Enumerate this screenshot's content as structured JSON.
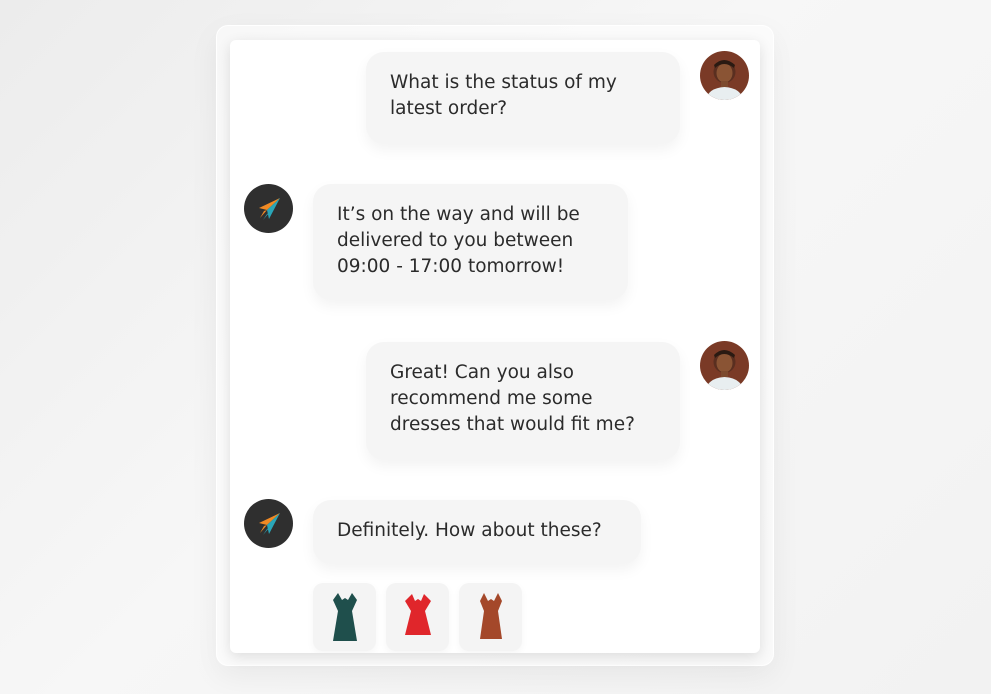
{
  "chat": {
    "messages": [
      {
        "sender": "user",
        "text": "What is the status of my\nlatest order?"
      },
      {
        "sender": "bot",
        "text": "It’s on the way and will be\ndelivered to you between\n09:00 - 17:00 tomorrow!"
      },
      {
        "sender": "user",
        "text": "Great! Can you also\nrecommend me some\ndresses that would fit me?"
      },
      {
        "sender": "bot",
        "text": "Definitely. How about these?"
      }
    ],
    "recommendations": [
      {
        "item": "dress-icon",
        "color": "#1f4f4c"
      },
      {
        "item": "dress-icon",
        "color": "#e0262b"
      },
      {
        "item": "dress-icon",
        "color": "#a4482a"
      }
    ]
  },
  "icons": {
    "user_avatar": "user-avatar",
    "bot_avatar": "paper-plane-icon"
  },
  "colors": {
    "bot_avatar_bg": "#2f2f2f",
    "plane_orange": "#f08a24",
    "plane_teal": "#2aa6b8",
    "bubble_bg": "#f5f5f5",
    "text": "#2b2b2b"
  }
}
